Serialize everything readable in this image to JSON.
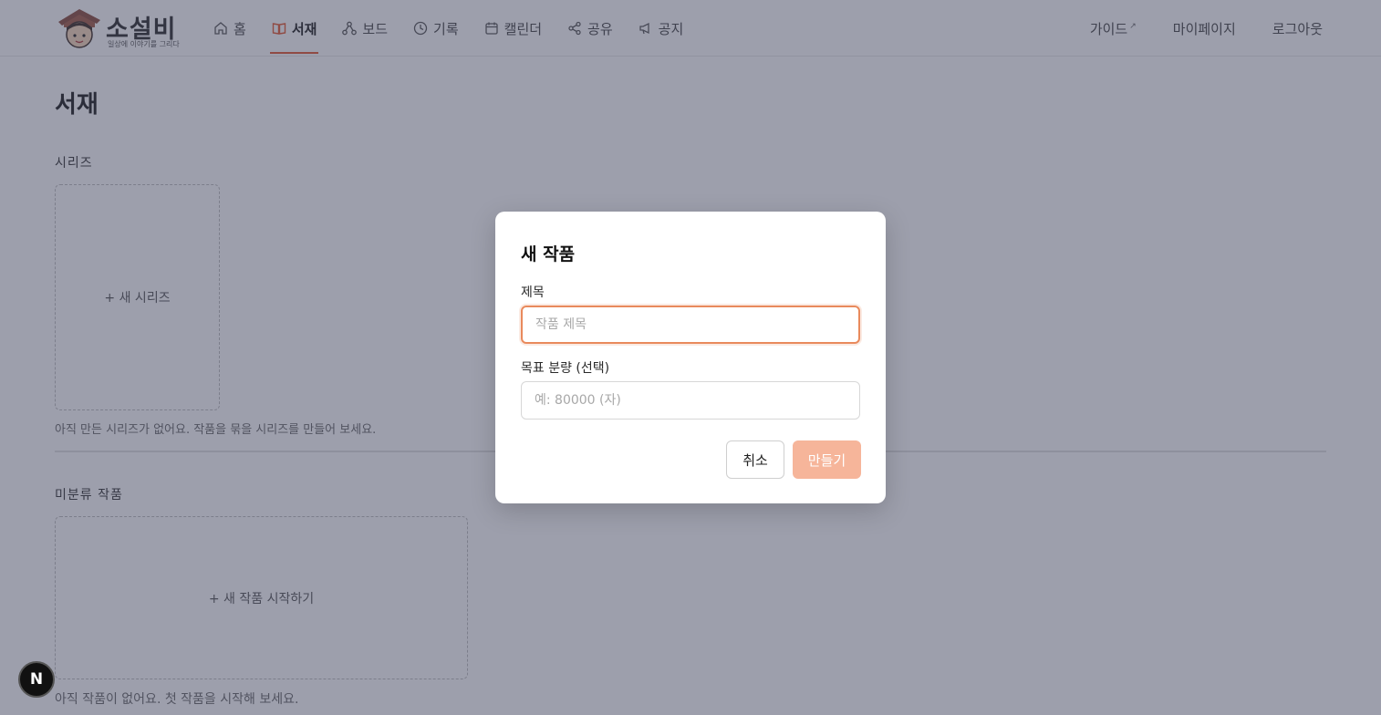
{
  "app": {
    "logo_text": "소설비",
    "logo_subtext": "일상에 이야기를 그리다"
  },
  "nav": {
    "items": [
      {
        "label": "홈",
        "icon": "home-icon"
      },
      {
        "label": "서재",
        "icon": "book-icon",
        "active": true
      },
      {
        "label": "보드",
        "icon": "network-icon"
      },
      {
        "label": "기록",
        "icon": "clock-icon"
      },
      {
        "label": "캘린더",
        "icon": "calendar-icon"
      },
      {
        "label": "공유",
        "icon": "share-icon"
      },
      {
        "label": "공지",
        "icon": "megaphone-icon"
      }
    ],
    "right": {
      "guide": "가이드",
      "guide_icon": "external-link-icon",
      "mypage": "마이페이지",
      "logout": "로그아웃"
    }
  },
  "page": {
    "title": "서재",
    "series": {
      "label": "시리즈",
      "new_card": "+ 새 시리즈",
      "empty_hint": "아직 만든 시리즈가 없어요. 작품을 묶을 시리즈를 만들어 보세요."
    },
    "uncategorized": {
      "label": "미분류 작품",
      "new_card": "+ 새 작품 시작하기",
      "empty_hint": "아직 작품이 없어요. 첫 작품을 시작해 보세요."
    }
  },
  "modal": {
    "title": "새 작품",
    "title_field": {
      "label": "제목",
      "placeholder": "작품 제목",
      "value": ""
    },
    "goal_field": {
      "label": "목표 분량 (선택)",
      "placeholder": "예: 80000 (자)",
      "value": ""
    },
    "cancel_label": "취소",
    "create_label": "만들기"
  },
  "badge": {
    "label": "N"
  },
  "colors": {
    "accent": "#e4572e",
    "focus_border": "#e98a5c",
    "create_button_disabled": "#f6b59a"
  }
}
